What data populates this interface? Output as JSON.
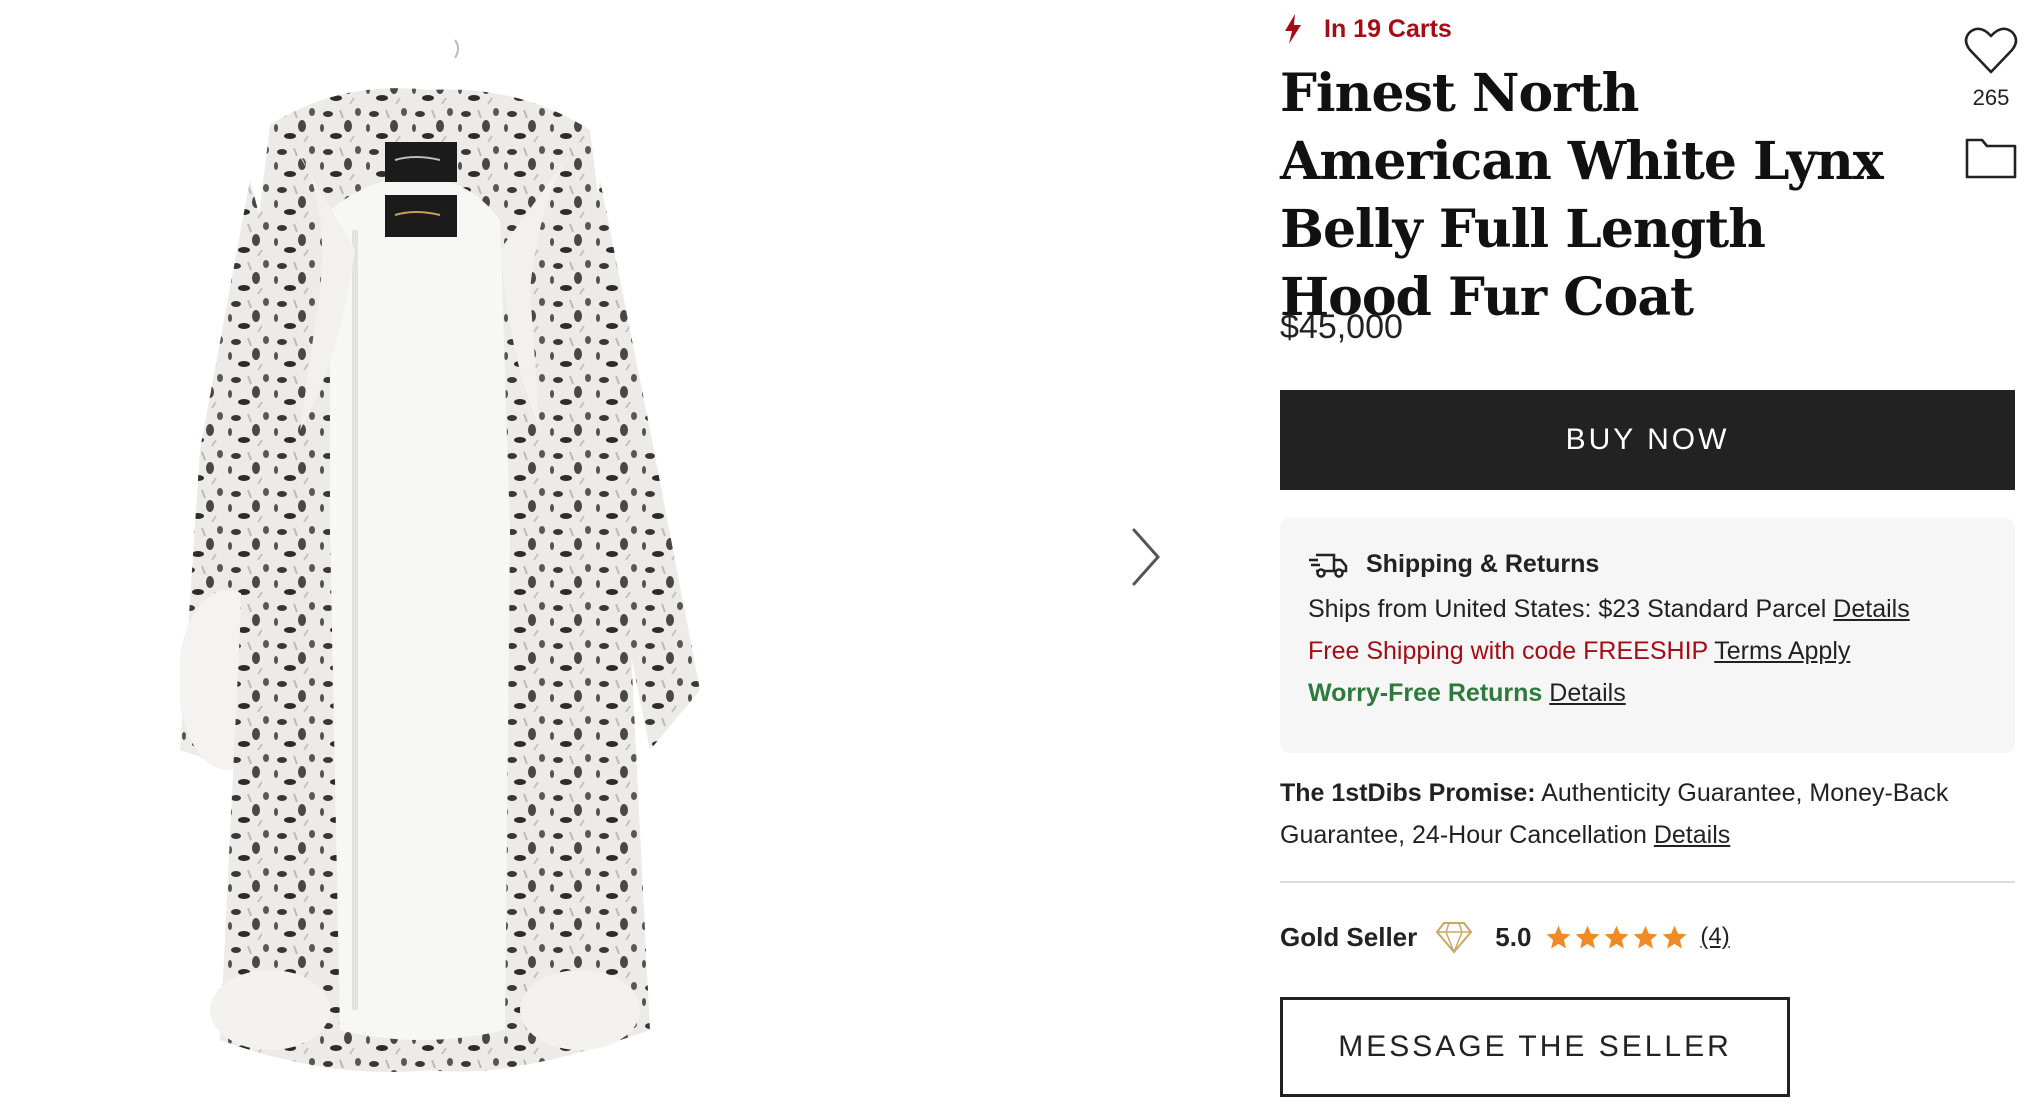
{
  "gallery": {
    "next_icon": "chevron-right-icon",
    "image_alt": "white-lynx-fur-coat"
  },
  "product": {
    "carts_text": "In 19 Carts",
    "carts_icon": "lightning-bolt-icon",
    "title": "Finest North American White Lynx Belly Full Length Hood Fur Coat",
    "favorites_count": "265",
    "price": "$45,000",
    "buy_label": "BUY NOW"
  },
  "shipping": {
    "heading": "Shipping & Returns",
    "ships_from": "Ships from United States: $23 Standard Parcel",
    "ships_details": "Details",
    "free_shipping": "Free Shipping with code FREESHIP",
    "terms_link": "Terms Apply",
    "returns": "Worry-Free Returns",
    "returns_details": "Details"
  },
  "promise": {
    "label": "The 1stDibs Promise:",
    "text": "Authenticity Guarantee, Money-Back Guarantee, 24-Hour Cancellation",
    "details": "Details"
  },
  "seller": {
    "tier": "Gold Seller",
    "rating": "5.0",
    "stars": 5,
    "reviews": "(4)",
    "message_label": "MESSAGE THE SELLER"
  },
  "colors": {
    "accent_red": "#a50d15",
    "green": "#2d7a3c",
    "star_orange": "#f08a24",
    "button_dark": "#222222"
  }
}
